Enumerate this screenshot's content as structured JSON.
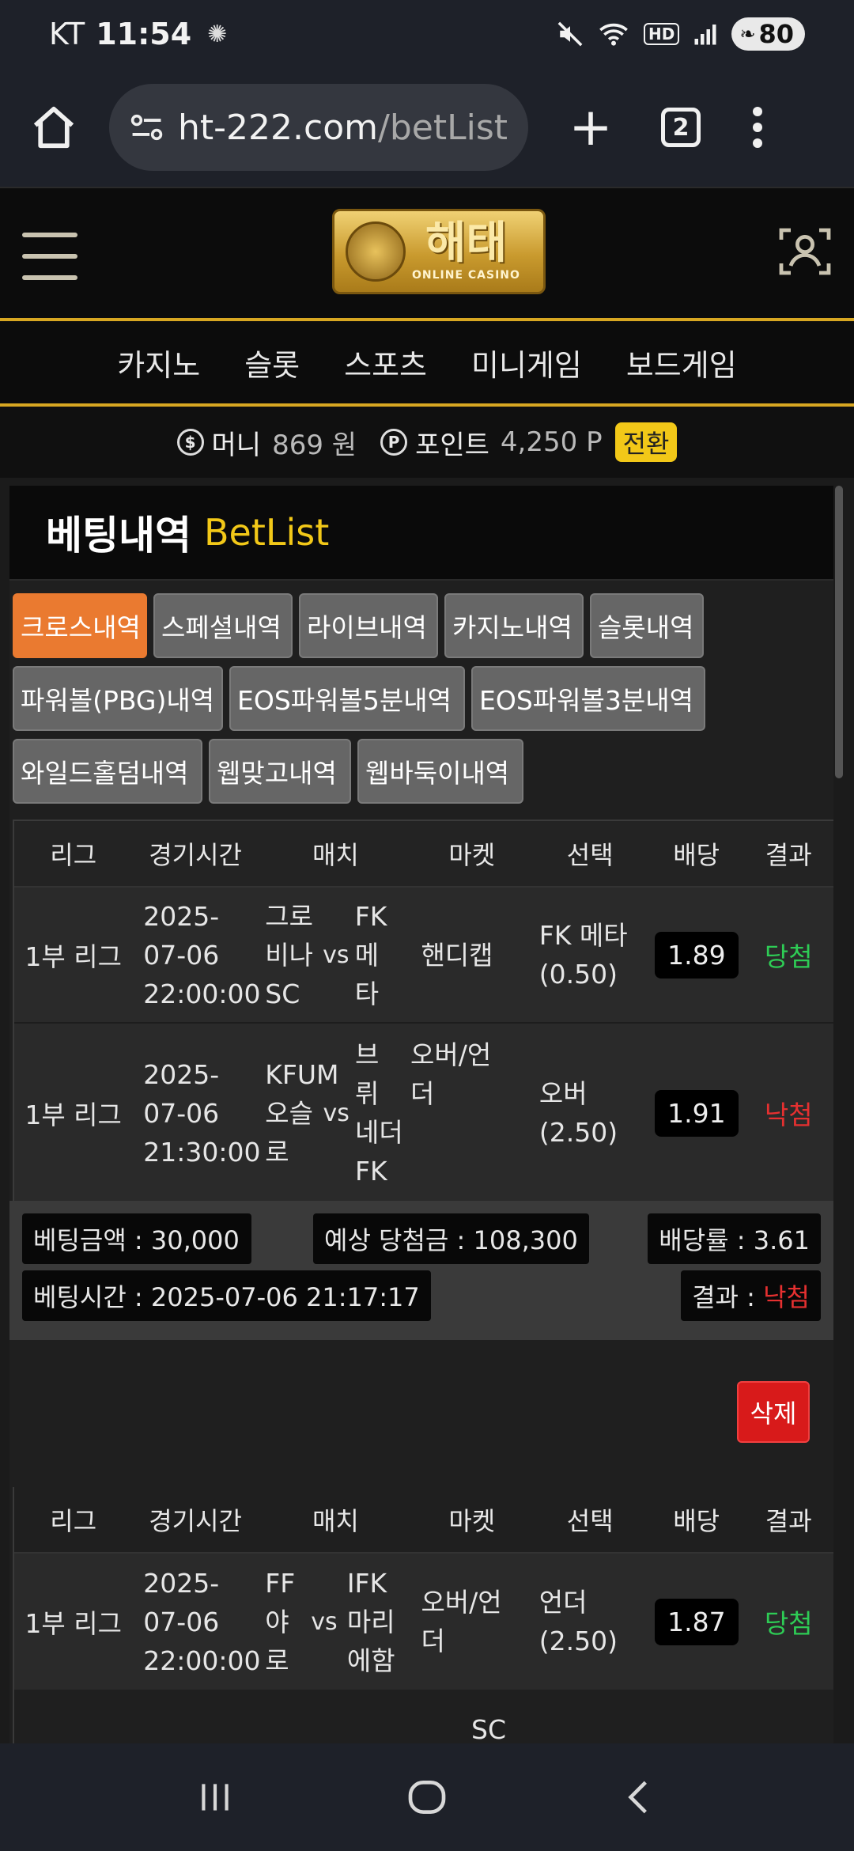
{
  "status": {
    "carrier": "KT",
    "time": "11:54",
    "hd": "HD",
    "battery": "80"
  },
  "browser": {
    "url_host": "ht-222.com",
    "url_path": "/betList",
    "tab_count": "2"
  },
  "logo": {
    "korean": "해태",
    "english": "ONLINE CASINO"
  },
  "nav": [
    "카지노",
    "슬롯",
    "스포츠",
    "미니게임",
    "보드게임"
  ],
  "balance": {
    "money_label": "머니",
    "money_value": "869 원",
    "point_label": "포인트",
    "point_value": "4,250 P",
    "convert_label": "전환"
  },
  "page": {
    "title_kr": "베팅내역",
    "title_en": "BetList"
  },
  "tabs": [
    [
      "크로스내역",
      "스페셜내역",
      "라이브내역",
      "카지노내역",
      "슬롯내역"
    ],
    [
      "파워볼(PBG)내역",
      "EOS파워볼5분내역",
      "EOS파워볼3분내역"
    ],
    [
      "와일드홀덤내역",
      "웹맞고내역",
      "웹바둑이내역"
    ]
  ],
  "table_headers": [
    "리그",
    "경기시간",
    "매치",
    "마켓",
    "선택",
    "배당",
    "결과"
  ],
  "bet1": {
    "rows": [
      {
        "league": "1부 리그",
        "time": "2025-\n07-06\n22:00:00",
        "home": "그로\n비나\nSC",
        "vs": "vs",
        "away": "FK\n메\n타",
        "market": "핸디캡",
        "pick": "FK 메타\n(0.50)",
        "odds": "1.89",
        "result": "당첨"
      },
      {
        "league": "1부 리그",
        "time": "2025-\n07-06\n21:30:00",
        "home": "KFUM\n오슬\n로",
        "vs": "vs",
        "away": "브\n뤼",
        "market": "오버/언\n더",
        "pick": "오버\n(2.50)",
        "odds": "1.91",
        "result": "낙첨"
      }
    ],
    "away_extra": "네더\nFK",
    "stake_label": "베팅금액 : 30,000",
    "expected_label": "예상 당첨금 : 108,300",
    "rate_label": "배당률 : 3.61",
    "time_label": "베팅시간 : 2025-07-06 21:17:17",
    "result_prefix": "결과 : ",
    "result_value": "낙첨"
  },
  "delete_label": "삭제",
  "bet2": {
    "rows": [
      {
        "league": "1부 리그",
        "time": "2025-\n07-06\n22:00:00",
        "home": "FF\n야\n로",
        "vs": "vs",
        "away": "IFK\n마리\n에함",
        "market": "오버/언\n더",
        "pick": "언더\n(2.50)",
        "odds": "1.87",
        "result": "당첨"
      }
    ],
    "trailing": "SC"
  },
  "colors": {
    "accent_gold": "#d8a722",
    "active_tab": "#ea7a30",
    "win": "#2ecc55",
    "lose": "#e63030",
    "delete": "#d81a1a",
    "title_en": "#f2c818"
  }
}
